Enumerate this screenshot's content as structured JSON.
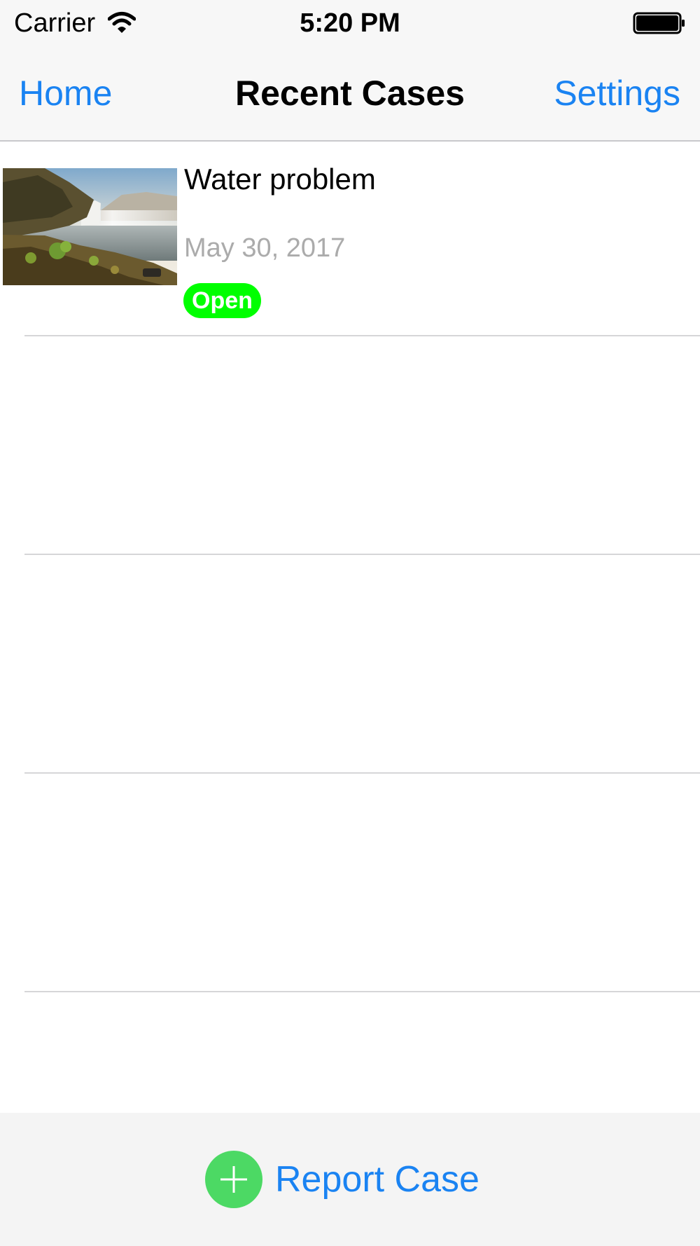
{
  "status_bar": {
    "carrier": "Carrier",
    "time": "5:20 PM",
    "wifi_icon": "wifi-icon",
    "battery_icon": "battery-full-icon"
  },
  "nav": {
    "left_button": "Home",
    "title": "Recent Cases",
    "right_button": "Settings"
  },
  "cases": [
    {
      "title": "Water problem",
      "date": "May 30, 2017",
      "status": "Open",
      "status_color": "#00ff00",
      "thumbnail": "waterfall-landscape-photo"
    }
  ],
  "bottom_bar": {
    "report_label": "Report Case",
    "report_icon": "plus-circle-icon",
    "icon_color": "#4cd964"
  },
  "colors": {
    "accent": "#1a83f2",
    "bar_background": "#f7f7f7",
    "secondary_text": "#ababab"
  }
}
